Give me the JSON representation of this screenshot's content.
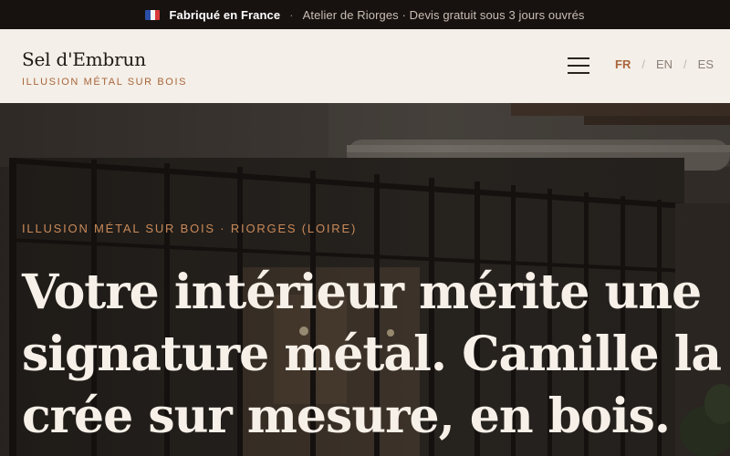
{
  "topbar": {
    "flag_icon": "france-flag-icon",
    "made_in": "Fabriqué en France",
    "separator": "·",
    "info": "Atelier de Riorges · Devis gratuit sous 3 jours ouvrés"
  },
  "header": {
    "brand_name": "Sel d'Embrun",
    "brand_tagline": "ILLUSION MÉTAL SUR BOIS",
    "menu_icon": "hamburger-menu-icon",
    "languages": [
      {
        "label": "FR",
        "active": true
      },
      {
        "label": "EN",
        "active": false
      },
      {
        "label": "ES",
        "active": false
      }
    ],
    "lang_separator": "/"
  },
  "hero": {
    "eyebrow": "ILLUSION MÉTAL SUR BOIS · RIORGES (LOIRE)",
    "title": "Votre intérieur mérite une signature métal. Camille la crée sur mesure, en bois."
  },
  "colors": {
    "accent": "#a8663c",
    "header_bg": "#f4efe8",
    "topbar_bg": "#171210",
    "hero_text": "#f6f0e8"
  }
}
